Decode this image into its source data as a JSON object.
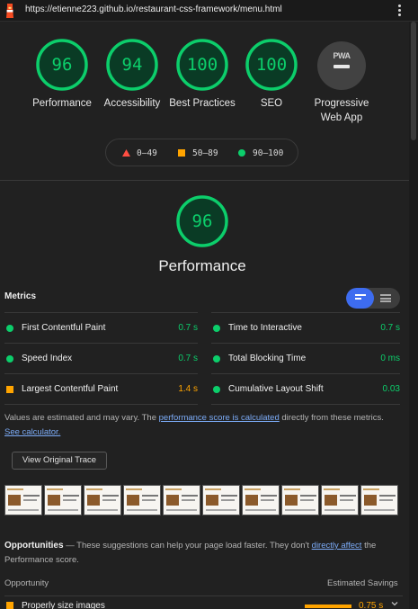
{
  "browser": {
    "url": "https://etienne223.github.io/restaurant-css-framework/menu.html"
  },
  "colors": {
    "pass": "#0cce6b",
    "average": "#ffa400",
    "fail": "#ff4e42",
    "link": "#7cacf8",
    "background": "#212121"
  },
  "gauges": [
    {
      "score": "96",
      "label": "Performance"
    },
    {
      "score": "94",
      "label": "Accessibility"
    },
    {
      "score": "100",
      "label": "Best Practices"
    },
    {
      "score": "100",
      "label": "SEO"
    }
  ],
  "pwa": {
    "badge": "PWA",
    "label": "Progressive Web App"
  },
  "legend": {
    "fail": "0–49",
    "average": "50–89",
    "pass": "90–100"
  },
  "performance": {
    "score": "96",
    "title": "Performance"
  },
  "metrics": {
    "title": "Metrics",
    "items": [
      {
        "name": "First Contentful Paint",
        "value": "0.7 s",
        "rating": "pass"
      },
      {
        "name": "Time to Interactive",
        "value": "0.7 s",
        "rating": "pass"
      },
      {
        "name": "Speed Index",
        "value": "0.7 s",
        "rating": "pass"
      },
      {
        "name": "Total Blocking Time",
        "value": "0 ms",
        "rating": "pass"
      },
      {
        "name": "Largest Contentful Paint",
        "value": "1.4 s",
        "rating": "average"
      },
      {
        "name": "Cumulative Layout Shift",
        "value": "0.03",
        "rating": "pass"
      }
    ],
    "note": {
      "prefix": "Values are estimated and may vary. The ",
      "link1": "performance score is calculated",
      "middle": " directly from these metrics. ",
      "link2": "See calculator."
    }
  },
  "trace_button": "View Original Trace",
  "opportunities": {
    "title": "Opportunities",
    "dash": " — ",
    "desc_prefix": "These suggestions can help your page load faster. They don't ",
    "desc_link": "directly affect",
    "desc_suffix": " the Performance score.",
    "col_opportunity": "Opportunity",
    "col_savings": "Estimated Savings",
    "rows": [
      {
        "name": "Properly size images",
        "savings": "0.75 s"
      }
    ]
  }
}
